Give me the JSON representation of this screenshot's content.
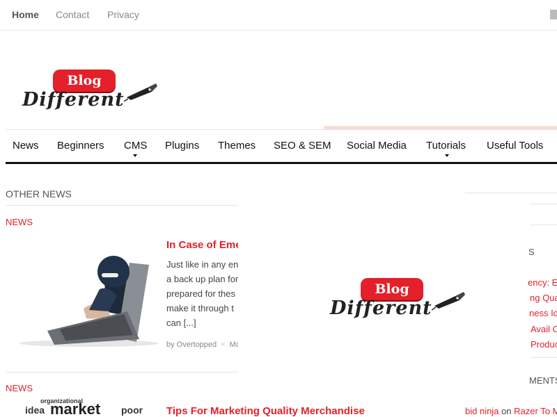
{
  "topnav": {
    "items": [
      {
        "label": "Home",
        "active": true
      },
      {
        "label": "Contact",
        "active": false
      },
      {
        "label": "Privacy",
        "active": false
      }
    ]
  },
  "logo": {
    "badge": "Blog",
    "script": "Different"
  },
  "mainnav": {
    "items": [
      "News",
      "Beginners",
      "CMS",
      "Plugins",
      "Themes",
      "SEO & SEM",
      "Social Media",
      "Tutorials",
      "Useful Tools"
    ]
  },
  "content": {
    "section_title": "OTHER NEWS",
    "posts": [
      {
        "category": "NEWS",
        "title": "In Case of Eme",
        "excerpt": [
          "Just like in any en",
          "a back up plan for",
          "prepared for thes",
          "make it through t",
          "can [...]"
        ],
        "author": "by Overtopped",
        "meta_more": "Ma"
      },
      {
        "category": "NEWS",
        "title": "Tips For Marketing Quality Merchandise"
      }
    ],
    "wordcloud": [
      "organizational",
      "idea",
      "market",
      "poor"
    ]
  },
  "overlay": {
    "badge": "Blog",
    "script": "Different"
  },
  "sidebar": {
    "heading_fragment": "S",
    "links": [
      "ency: E",
      "ng Qua",
      "ness Id",
      "Avail O",
      "Produc"
    ],
    "comments_heading": "MENTS",
    "comment": {
      "author": "bid ninja",
      "on": "on",
      "post": "Razer To M"
    }
  },
  "colors": {
    "accent": "#e4202a",
    "text": "#333333",
    "rule": "#e5e5e5"
  }
}
